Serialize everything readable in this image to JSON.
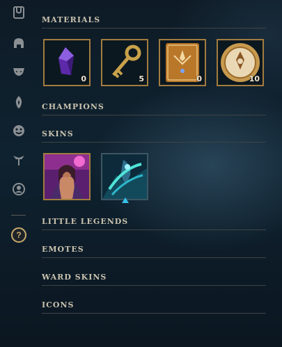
{
  "sidebar": {
    "items": [
      {
        "icon": "bag-icon"
      },
      {
        "icon": "helmet-icon"
      },
      {
        "icon": "mask-icon"
      },
      {
        "icon": "flame-icon"
      },
      {
        "icon": "emote-face-icon"
      },
      {
        "icon": "ward-icon"
      },
      {
        "icon": "profile-icon"
      }
    ],
    "help_label": "?"
  },
  "sections": {
    "materials": "MATERIALS",
    "champions": "CHAMPIONS",
    "skins": "SKINS",
    "little_legends": "LITTLE LEGENDS",
    "emotes": "EMOTES",
    "ward_skins": "WARD SKINS",
    "icons": "ICONS"
  },
  "materials": [
    {
      "name": "gem-icon",
      "count": "0"
    },
    {
      "name": "key-icon",
      "count": "5"
    },
    {
      "name": "token-card-icon",
      "count": "0"
    },
    {
      "name": "coin-icon",
      "count": "10"
    }
  ],
  "skins": [
    {
      "name": "skin-portrait-purple"
    },
    {
      "name": "skin-portrait-teal"
    }
  ],
  "colors": {
    "gold": "#a27c3e",
    "accent": "#37c1e8"
  }
}
